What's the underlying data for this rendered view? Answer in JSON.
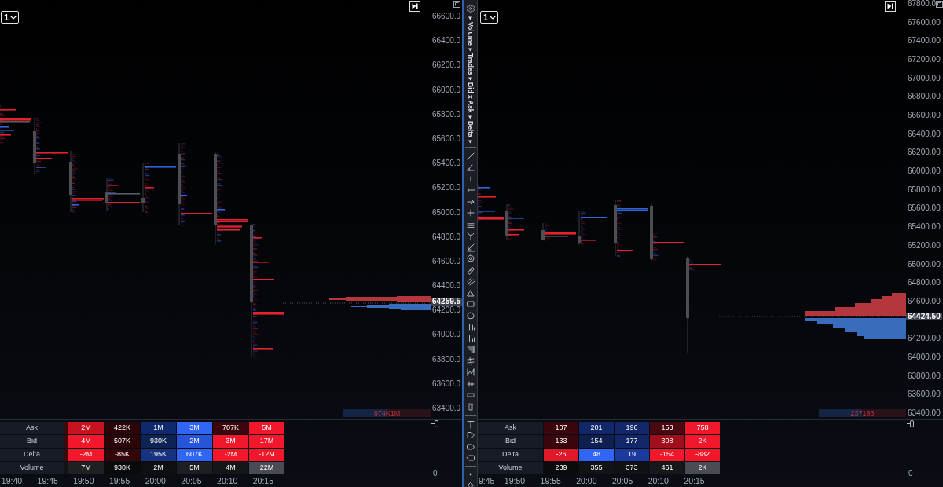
{
  "left_panel": {
    "interval": "1",
    "price_ticks": [
      "66600.0",
      "66400.0",
      "66200.0",
      "66000.0",
      "65800.0",
      "65600.0",
      "65400.0",
      "65200.0",
      "65000.0",
      "64800.0",
      "64600.0",
      "64400.0",
      "64200.0",
      "64000.0",
      "63800.0",
      "63600.0",
      "63400.0"
    ],
    "last_price": "64259.5",
    "volume_summary": "874K1M",
    "stats_table": {
      "rows": [
        {
          "label": "Ask",
          "cells": [
            {
              "color": "#3a0a0e"
            },
            {
              "text": "2M",
              "color": "#c9121f"
            },
            {
              "text": "422K",
              "color": "#2b0508"
            },
            {
              "text": "1M",
              "color": "#10286c"
            },
            {
              "text": "3M",
              "color": "#2f66f6"
            },
            {
              "text": "707K",
              "color": "#3b070c"
            },
            {
              "text": "5M",
              "color": "#f2172b"
            }
          ]
        },
        {
          "label": "Bid",
          "cells": [
            {
              "color": "#3a0a0e"
            },
            {
              "text": "4M",
              "color": "#f2172b"
            },
            {
              "text": "507K",
              "color": "#2b0508"
            },
            {
              "text": "930K",
              "color": "#0e2352"
            },
            {
              "text": "2M",
              "color": "#2556d8"
            },
            {
              "text": "3M",
              "color": "#f2172b"
            },
            {
              "text": "17M",
              "color": "#f2172b"
            }
          ]
        },
        {
          "label": "Delta",
          "cells": [
            {
              "color": "#3a0a0e"
            },
            {
              "text": "-2M",
              "color": "#f2172b"
            },
            {
              "text": "-85K",
              "color": "#34060a"
            },
            {
              "text": "195K",
              "color": "#17337f"
            },
            {
              "text": "607K",
              "color": "#2f66f6"
            },
            {
              "text": "-2M",
              "color": "#f2172b"
            },
            {
              "text": "-12M",
              "color": "#f2172b"
            }
          ]
        },
        {
          "label": "Volume",
          "cells": [
            {
              "color": "#111215"
            },
            {
              "text": "7M",
              "color": "#1f2024"
            },
            {
              "text": "930K",
              "color": "#0a0a0b"
            },
            {
              "text": "2M",
              "color": "#0e0f11"
            },
            {
              "text": "5M",
              "color": "#1d1e22"
            },
            {
              "text": "4M",
              "color": "#15161a"
            },
            {
              "text": "22M",
              "color": "#4a4c55"
            }
          ]
        }
      ]
    },
    "lower_scale": "0",
    "time_labels": [
      "19:40",
      "19:45",
      "19:50",
      "19:55",
      "20:00",
      "20:05",
      "20:10",
      "20:15"
    ]
  },
  "toolbar": {
    "menus": [
      "Volume",
      "Trades",
      "Bid x Ask",
      "Delta"
    ]
  },
  "right_panel": {
    "interval": "1",
    "price_ticks": [
      "67800.0",
      "67600.00",
      "67400.00",
      "67200.00",
      "67000.00",
      "66800.00",
      "66600.00",
      "66400.00",
      "66200.00",
      "66000.00",
      "65800.00",
      "65600.00",
      "65400.00",
      "65200.00",
      "65000.00",
      "64800.00",
      "64600.00",
      "64200.00",
      "64000.00",
      "63800.00",
      "63600.00",
      "63400.00"
    ],
    "last_price": "64424.50",
    "volume_summary": "237193",
    "stats_table": {
      "rows": [
        {
          "label": "Ask",
          "cells": [
            {
              "text": "107",
              "color": "#3a060b"
            },
            {
              "text": "201",
              "color": "#12266a"
            },
            {
              "text": "196",
              "color": "#12266a"
            },
            {
              "text": "153",
              "color": "#4a0810"
            },
            {
              "text": "758",
              "color": "#f2172b"
            }
          ]
        },
        {
          "label": "Bid",
          "cells": [
            {
              "text": "133",
              "color": "#3a060b"
            },
            {
              "text": "154",
              "color": "#0f1f50"
            },
            {
              "text": "177",
              "color": "#12266a"
            },
            {
              "text": "308",
              "color": "#a0101c"
            },
            {
              "text": "2K",
              "color": "#f2172b"
            }
          ]
        },
        {
          "label": "Delta",
          "cells": [
            {
              "text": "-26",
              "color": "#e0182a"
            },
            {
              "text": "48",
              "color": "#2f66f6"
            },
            {
              "text": "19",
              "color": "#1b3aa0"
            },
            {
              "text": "-154",
              "color": "#f2172b"
            },
            {
              "text": "-882",
              "color": "#f2172b"
            }
          ]
        },
        {
          "label": "Volume",
          "cells": [
            {
              "text": "239",
              "color": "#0b0b0c"
            },
            {
              "text": "355",
              "color": "#121316"
            },
            {
              "text": "373",
              "color": "#101114"
            },
            {
              "text": "461",
              "color": "#17181b"
            },
            {
              "text": "2K",
              "color": "#4a4c55"
            }
          ]
        }
      ]
    },
    "lower_scale": "0",
    "time_labels": [
      "9:45",
      "19:50",
      "19:55",
      "20:00",
      "20:05",
      "20:10",
      "20:15"
    ]
  }
}
